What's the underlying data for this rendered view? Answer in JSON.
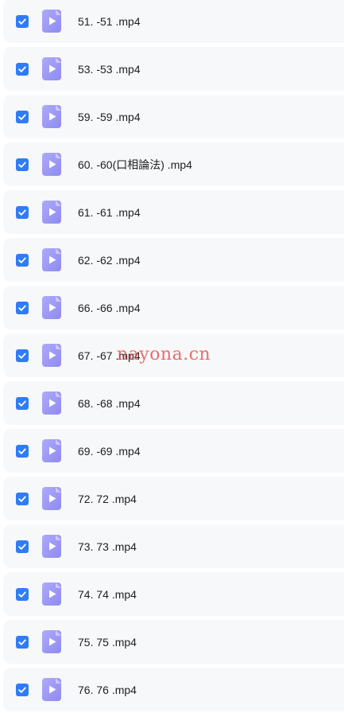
{
  "files": [
    {
      "name": "51. -51 .mp4",
      "checked": true
    },
    {
      "name": "53. -53 .mp4",
      "checked": true
    },
    {
      "name": "59. -59 .mp4",
      "checked": true
    },
    {
      "name": "60. -60(口相論法) .mp4",
      "checked": true
    },
    {
      "name": "61. -61 .mp4",
      "checked": true
    },
    {
      "name": "62. -62 .mp4",
      "checked": true
    },
    {
      "name": "66. -66 .mp4",
      "checked": true
    },
    {
      "name": "67. -67 .mp4",
      "checked": true
    },
    {
      "name": "68. -68 .mp4",
      "checked": true
    },
    {
      "name": "69. -69 .mp4",
      "checked": true
    },
    {
      "name": "72. 72 .mp4",
      "checked": true
    },
    {
      "name": "73. 73 .mp4",
      "checked": true
    },
    {
      "name": "74. 74 .mp4",
      "checked": true
    },
    {
      "name": "75. 75 .mp4",
      "checked": true
    },
    {
      "name": "76. 76 .mp4",
      "checked": true
    }
  ],
  "watermark": "nayona.cn",
  "colors": {
    "checkbox": "#2f7cf6",
    "file_icon": "#9d98f6",
    "row_background": "#f7f8fa"
  },
  "icons": {
    "checkbox": "checkmark-icon",
    "file": "video-file-icon"
  }
}
